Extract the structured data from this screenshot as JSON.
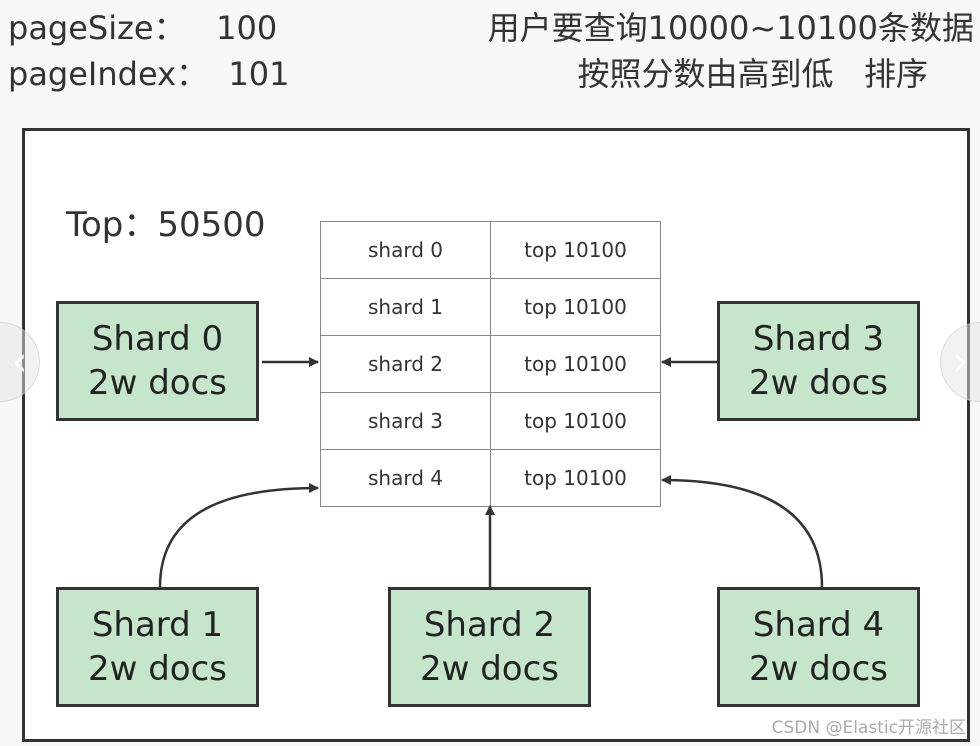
{
  "header": {
    "page_size": "pageSize：   100",
    "page_index": "pageIndex：  101",
    "query_desc": "用户要查询10000~10100条数据",
    "sort_desc": "按照分数由高到低   排序"
  },
  "diagram": {
    "top_label": "Top：50500",
    "shards": [
      {
        "name": "Shard 0",
        "docs": "2w docs"
      },
      {
        "name": "Shard 1",
        "docs": "2w docs"
      },
      {
        "name": "Shard 2",
        "docs": "2w docs"
      },
      {
        "name": "Shard 3",
        "docs": "2w docs"
      },
      {
        "name": "Shard 4",
        "docs": "2w docs"
      }
    ],
    "table": [
      [
        "shard 0",
        "top 10100"
      ],
      [
        "shard 1",
        "top 10100"
      ],
      [
        "shard 2",
        "top 10100"
      ],
      [
        "shard 3",
        "top 10100"
      ],
      [
        "shard 4",
        "top 10100"
      ]
    ],
    "shard_fill": "#c6e6cb"
  },
  "nav": {
    "prev_icon": "chevron-left-icon",
    "next_icon": "chevron-right-icon"
  },
  "watermark": "CSDN @Elastic开源社区"
}
